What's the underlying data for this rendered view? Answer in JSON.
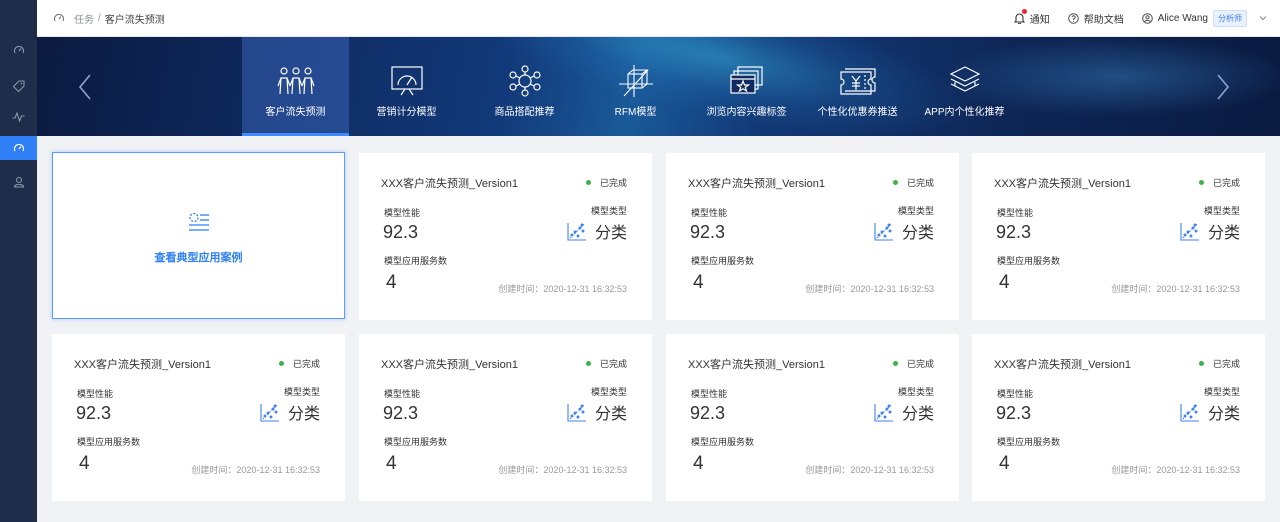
{
  "breadcrumb": {
    "root": "任务",
    "separator": "/",
    "current": "客户流失预测"
  },
  "header": {
    "notify_label": "通知",
    "help_label": "帮助文档",
    "user_name": "Alice Wang",
    "user_role": "分析师"
  },
  "sidebar": {
    "items": [
      {
        "icon": "gauge-icon",
        "active": false
      },
      {
        "icon": "tag-icon",
        "active": false
      },
      {
        "icon": "pulse-icon",
        "active": false
      },
      {
        "icon": "gauge-icon",
        "active": true
      },
      {
        "icon": "user-icon",
        "active": false
      }
    ]
  },
  "banner": {
    "tabs": [
      {
        "label": "客户流失预测",
        "icon": "people-group-icon",
        "active": true
      },
      {
        "label": "营销计分模型",
        "icon": "dashboard-icon",
        "active": false
      },
      {
        "label": "商品搭配推荐",
        "icon": "network-icon",
        "active": false
      },
      {
        "label": "RFM模型",
        "icon": "cube-axis-icon",
        "active": false
      },
      {
        "label": "浏览内容兴趣标签",
        "icon": "browser-star-icon",
        "active": false
      },
      {
        "label": "个性化优惠券推送",
        "icon": "coupon-icon",
        "active": false
      },
      {
        "label": "APP内个性化推荐",
        "icon": "layers-icon",
        "active": false
      }
    ]
  },
  "example_card": {
    "label": "查看典型应用案例",
    "icon": "list-icon"
  },
  "cards": [
    {
      "title": "XXX客户流失预测_Version1",
      "status": "已完成",
      "perf_label": "模型性能",
      "perf_value": "92.3",
      "type_label": "模型类型",
      "type_value": "分类",
      "svc_label": "模型应用服务数",
      "svc_value": "4",
      "created": "创建时间：2020-12-31 16:32:53"
    },
    {
      "title": "XXX客户流失预测_Version1",
      "status": "已完成",
      "perf_label": "模型性能",
      "perf_value": "92.3",
      "type_label": "模型类型",
      "type_value": "分类",
      "svc_label": "模型应用服务数",
      "svc_value": "4",
      "created": "创建时间：2020-12-31 16:32:53"
    },
    {
      "title": "XXX客户流失预测_Version1",
      "status": "已完成",
      "perf_label": "模型性能",
      "perf_value": "92.3",
      "type_label": "模型类型",
      "type_value": "分类",
      "svc_label": "模型应用服务数",
      "svc_value": "4",
      "created": "创建时间：2020-12-31 16:32:53"
    },
    {
      "title": "XXX客户流失预测_Version1",
      "status": "已完成",
      "perf_label": "模型性能",
      "perf_value": "92.3",
      "type_label": "模型类型",
      "type_value": "分类",
      "svc_label": "模型应用服务数",
      "svc_value": "4",
      "created": "创建时间：2020-12-31 16:32:53"
    },
    {
      "title": "XXX客户流失预测_Version1",
      "status": "已完成",
      "perf_label": "模型性能",
      "perf_value": "92.3",
      "type_label": "模型类型",
      "type_value": "分类",
      "svc_label": "模型应用服务数",
      "svc_value": "4",
      "created": "创建时间：2020-12-31 16:32:53"
    },
    {
      "title": "XXX客户流失预测_Version1",
      "status": "已完成",
      "perf_label": "模型性能",
      "perf_value": "92.3",
      "type_label": "模型类型",
      "type_value": "分类",
      "svc_label": "模型应用服务数",
      "svc_value": "4",
      "created": "创建时间：2020-12-31 16:32:53"
    },
    {
      "title": "XXX客户流失预测_Version1",
      "status": "已完成",
      "perf_label": "模型性能",
      "perf_value": "92.3",
      "type_label": "模型类型",
      "type_value": "分类",
      "svc_label": "模型应用服务数",
      "svc_value": "4",
      "created": "创建时间：2020-12-31 16:32:53"
    }
  ],
  "colors": {
    "sidebar_bg": "#1f2d4a",
    "accent": "#2f7ff7",
    "status_done": "#3cb34a",
    "notify_dot": "#f5222d"
  }
}
